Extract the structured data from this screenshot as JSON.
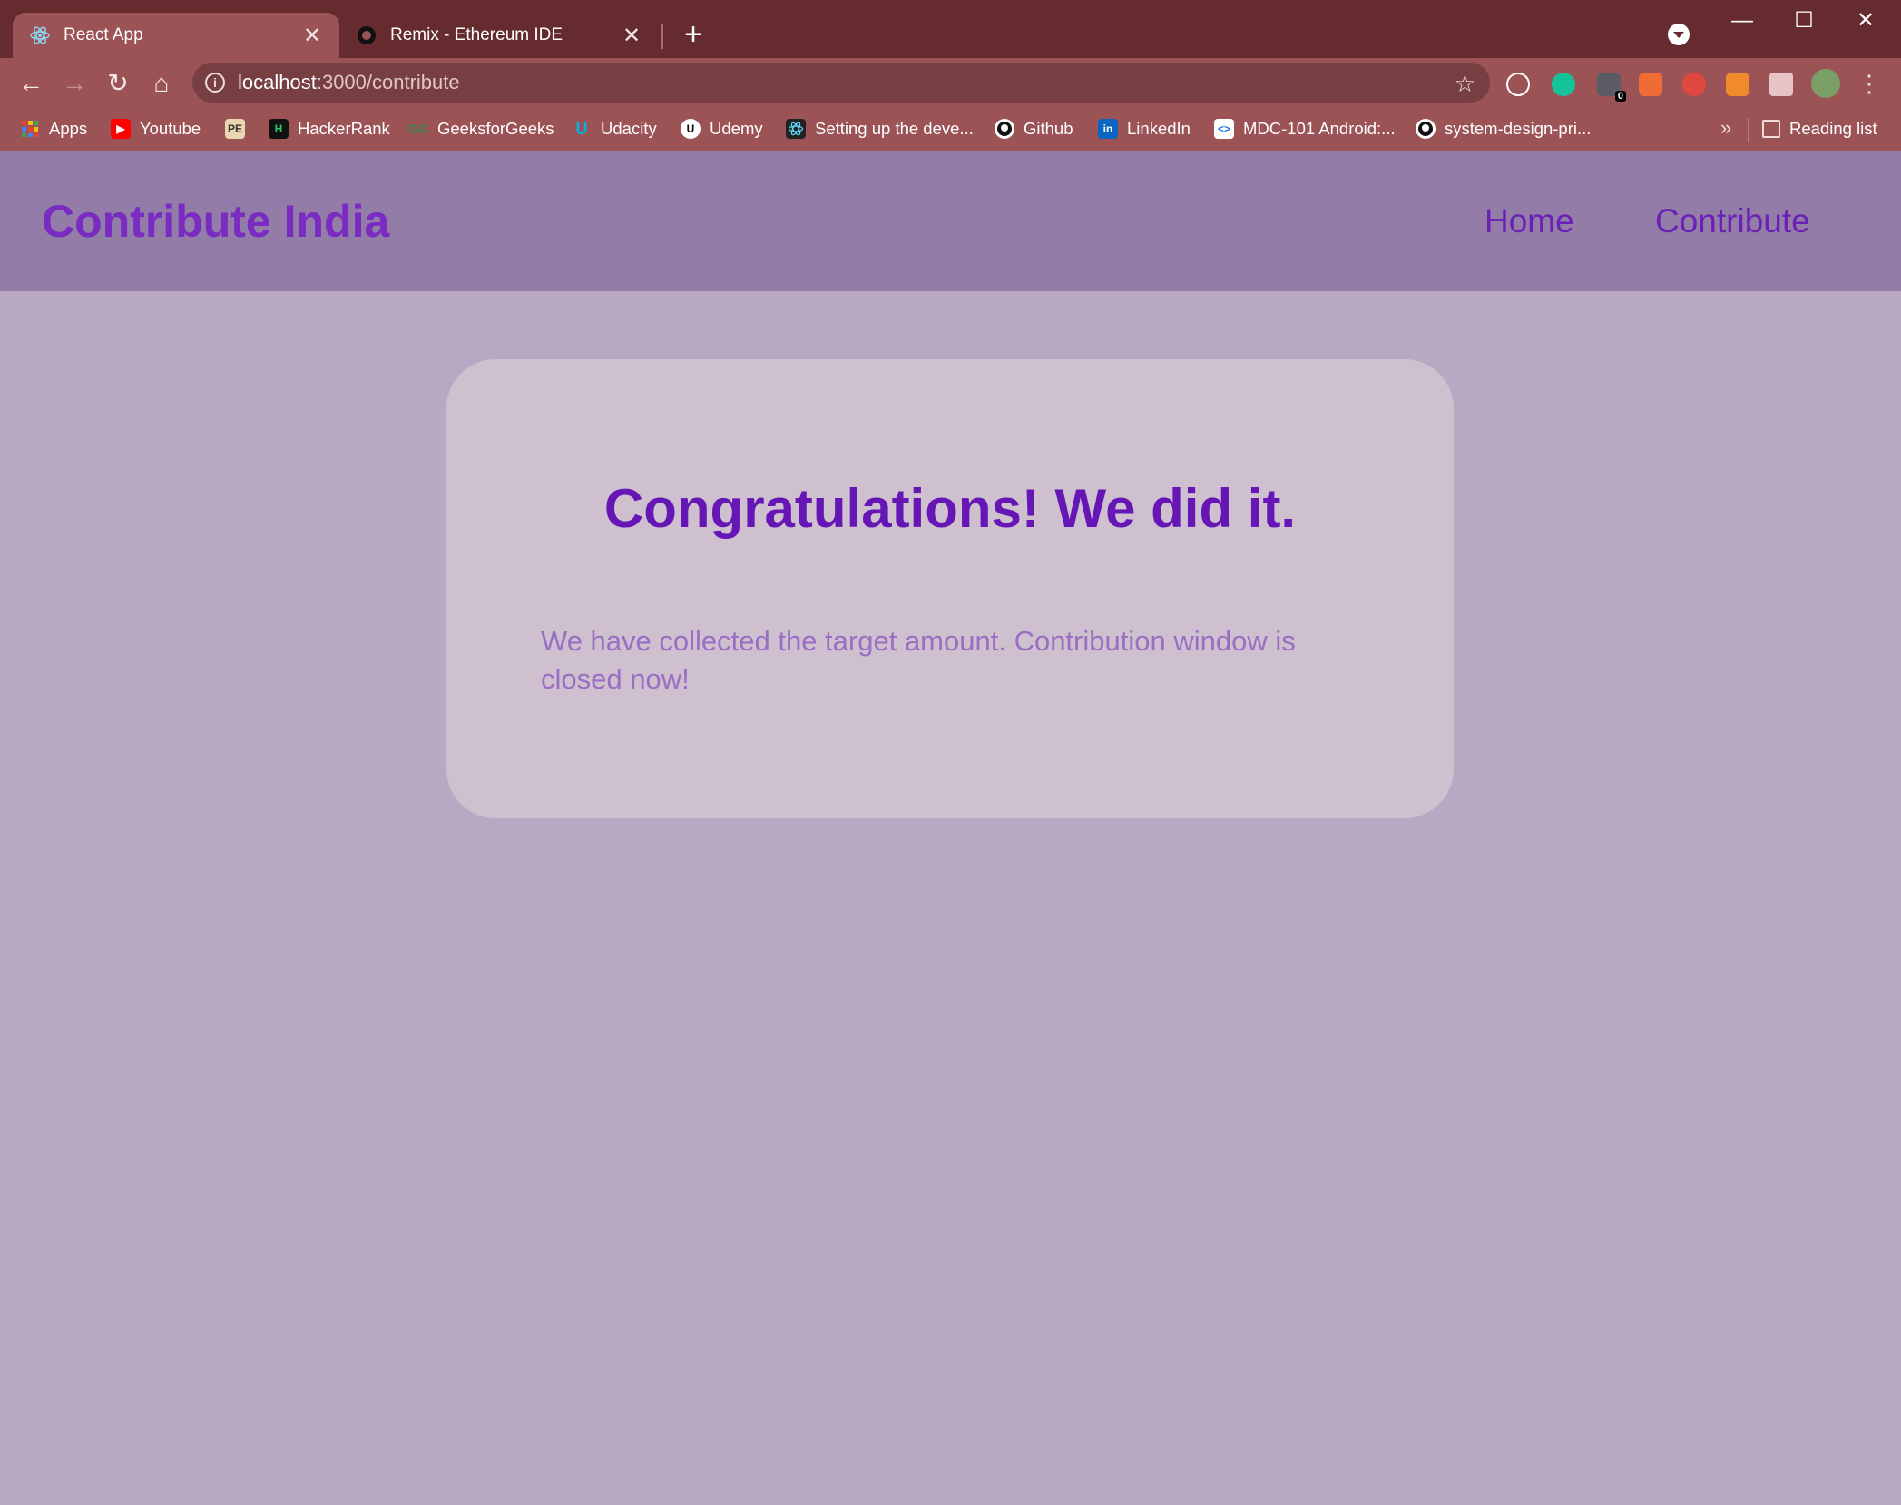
{
  "browser": {
    "tabs": [
      {
        "title": "React App",
        "active": true,
        "icon": "react-icon"
      },
      {
        "title": "Remix - Ethereum IDE",
        "active": false,
        "icon": "remix-icon"
      }
    ],
    "close_glyph": "✕",
    "new_tab_glyph": "+",
    "window_controls": {
      "minimize": "—",
      "maximize": "☐",
      "close": "✕"
    },
    "nav": {
      "back": "←",
      "forward": "→",
      "reload": "↻",
      "home": "⌂"
    },
    "url": {
      "host": "localhost",
      "path": ":3000/contribute"
    },
    "info_glyph": "i",
    "star_glyph": "☆",
    "menu_glyph": "⋮",
    "extension_badge": "0",
    "bookmarks": [
      {
        "label": "Apps",
        "icon": "apps-grid-icon",
        "color": "#e94235"
      },
      {
        "label": "Youtube",
        "icon": "youtube-icon",
        "color": "#ff0000"
      },
      {
        "label": "",
        "icon": "pe-icon",
        "color": "#e8d7b0"
      },
      {
        "label": "HackerRank",
        "icon": "hackerrank-icon",
        "color": "#111111"
      },
      {
        "label": "GeeksforGeeks",
        "icon": "geeksforgeeks-icon",
        "color": "#2f8d46"
      },
      {
        "label": "Udacity",
        "icon": "udacity-icon",
        "color": "#02b3e4"
      },
      {
        "label": "Udemy",
        "icon": "udemy-icon",
        "color": "#ffffff"
      },
      {
        "label": "Setting up the deve...",
        "icon": "react-icon",
        "color": "#222222"
      },
      {
        "label": "Github",
        "icon": "github-icon",
        "color": "#ffffff"
      },
      {
        "label": "LinkedIn",
        "icon": "linkedin-icon",
        "color": "#0a66c2"
      },
      {
        "label": "MDC-101 Android:...",
        "icon": "codelabs-icon",
        "color": "#ffffff"
      },
      {
        "label": "system-design-pri...",
        "icon": "github-icon",
        "color": "#ffffff"
      }
    ],
    "more_bookmarks": "»",
    "reading_list": "Reading list"
  },
  "app": {
    "brand": "Contribute India",
    "nav": [
      {
        "label": "Home"
      },
      {
        "label": "Contribute"
      }
    ],
    "card": {
      "title": "Congratulations! We did it.",
      "message": "We have collected the target amount. Contribution window is closed now!"
    }
  },
  "colors": {
    "chrome": "#652b2e",
    "toolbar": "#9c5356",
    "header": "#937ca8",
    "page": "#b9a8c3",
    "card": "#cec0cf",
    "accent": "#6516b5"
  }
}
